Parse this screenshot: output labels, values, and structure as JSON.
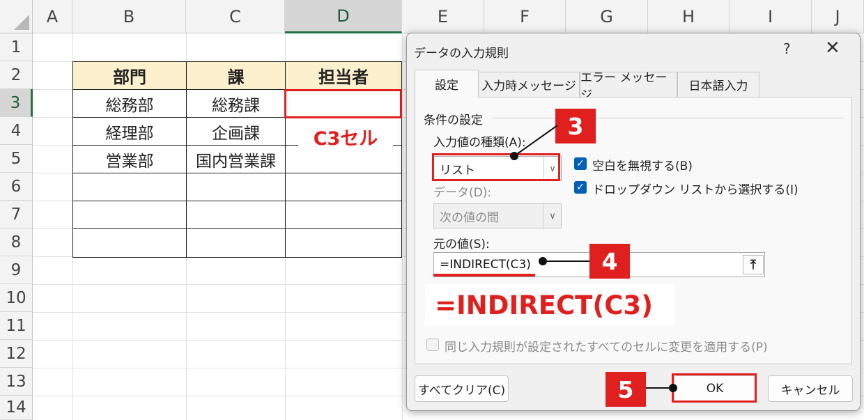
{
  "sheet": {
    "columns": [
      "A",
      "B",
      "C",
      "D",
      "E",
      "F",
      "G",
      "H",
      "I",
      "J"
    ],
    "rows": [
      "1",
      "2",
      "3",
      "4",
      "5",
      "6",
      "7",
      "8",
      "9",
      "10",
      "11",
      "12",
      "13",
      "14"
    ],
    "selected_column": "D",
    "selected_row": "3",
    "table_headers": [
      "部門",
      "課",
      "担当者"
    ],
    "table_rows": [
      [
        "総務部",
        "総務課",
        ""
      ],
      [
        "経理部",
        "企画課",
        ""
      ],
      [
        "営業部",
        "国内営業課",
        ""
      ],
      [
        "",
        "",
        ""
      ],
      [
        "",
        "",
        ""
      ],
      [
        "",
        "",
        ""
      ]
    ],
    "header_fill": "#fdf0cd"
  },
  "annotations": {
    "cell_label": "C3セル",
    "step3": "3",
    "step4": "4",
    "step5": "5",
    "formula_callout": "=INDIRECT(C3)",
    "accent_color": "#e0201f"
  },
  "dialog": {
    "title": "データの入力規則",
    "help": "?",
    "close": "✕",
    "tabs": [
      "設定",
      "入力時メッセージ",
      "エラー メッセージ",
      "日本語入力"
    ],
    "active_tab": "設定",
    "section_label": "条件の設定",
    "allow_label": "入力値の種類(A):",
    "allow_value": "リスト",
    "ignore_blank_label": "空白を無視する(B)",
    "ignore_blank_checked": true,
    "dropdown_label": "ドロップダウン リストから選択する(I)",
    "dropdown_checked": true,
    "data_label": "データ(D):",
    "data_value": "次の値の間",
    "source_label": "元の値(S):",
    "source_value": "=INDIRECT(C3)",
    "apply_all_label": "同じ入力規則が設定されたすべてのセルに変更を適用する(P)",
    "apply_all_checked": false,
    "clear_all_button": "すべてクリア(C)",
    "ok_button": "OK",
    "cancel_button": "キャンセル"
  }
}
